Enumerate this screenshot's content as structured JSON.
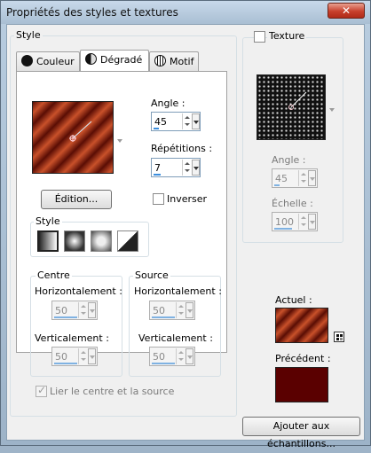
{
  "window": {
    "title": "Propriétés des styles et textures",
    "close_symbol": "✕"
  },
  "style_group": {
    "label": "Style"
  },
  "tabs": [
    {
      "label": "Couleur",
      "icon": "black-circle-icon"
    },
    {
      "label": "Dégradé",
      "icon": "gradient-circle-icon"
    },
    {
      "label": "Motif",
      "icon": "globe-pattern-icon"
    }
  ],
  "gradient": {
    "angle_label": "Angle :",
    "angle_value": "45",
    "repetitions_label": "Répétitions :",
    "repetitions_value": "7",
    "edit_button": "Édition...",
    "invert_label": "Inverser",
    "style_label": "Style",
    "style_options": [
      "linear-style-icon",
      "rectangular-style-icon",
      "sunburst-style-icon",
      "radial-style-icon"
    ],
    "colors": {
      "dark": "#5a0d04",
      "light": "#c9512a"
    }
  },
  "centre": {
    "label": "Centre",
    "horizontal_label": "Horizontalement :",
    "horizontal_value": "50",
    "vertical_label": "Verticalement :",
    "vertical_value": "50"
  },
  "source": {
    "label": "Source",
    "horizontal_label": "Horizontalement :",
    "horizontal_value": "50",
    "vertical_label": "Verticalement :",
    "vertical_value": "50"
  },
  "link_label": "Lier le centre et la source",
  "texture": {
    "label": "Texture",
    "angle_label": "Angle :",
    "angle_value": "45",
    "scale_label": "Échelle :",
    "scale_value": "100"
  },
  "current": {
    "label": "Actuel :"
  },
  "previous": {
    "label": "Précédent :",
    "color": "#5a0000"
  },
  "add_samples_button": "Ajouter aux échantillons..."
}
